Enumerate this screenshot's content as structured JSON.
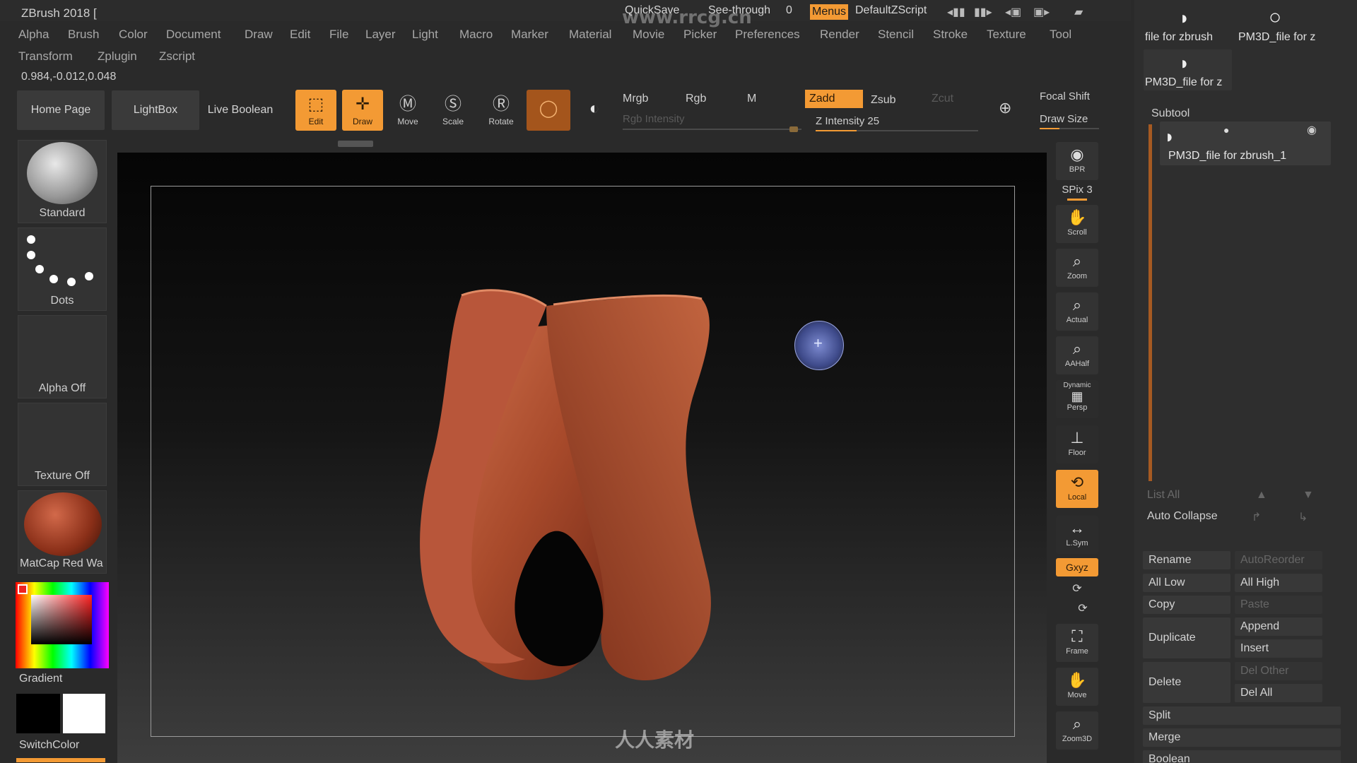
{
  "app": {
    "title": "ZBrush 2018 ["
  },
  "topbar": {
    "quicksave": "QuickSave",
    "see_through_label": "See-through",
    "see_through_value": "0",
    "menus": "Menus",
    "script": "DefaultZScript"
  },
  "menus": {
    "row1": [
      "Alpha",
      "Brush",
      "Color",
      "Document",
      "Draw",
      "Edit",
      "File",
      "Layer",
      "Light",
      "Macro",
      "Marker",
      "Material",
      "Movie",
      "Picker",
      "Preferences",
      "Render",
      "Stencil",
      "Stroke",
      "Texture",
      "Tool"
    ],
    "row2": [
      "Transform",
      "Zplugin",
      "Zscript"
    ]
  },
  "coords": "0.984,-0.012,0.048",
  "toolbar": {
    "home": "Home Page",
    "lightbox": "LightBox",
    "live_boolean": "Live Boolean",
    "edit": "Edit",
    "draw": "Draw",
    "move": "Move",
    "scale": "Scale",
    "rotate": "Rotate",
    "mrgb": "Mrgb",
    "rgb": "Rgb",
    "m": "M",
    "zadd": "Zadd",
    "zsub": "Zsub",
    "zcut": "Zcut",
    "rgb_intensity": "Rgb Intensity",
    "z_intensity": "Z Intensity 25",
    "z_intensity_value": 25,
    "focal_shift": "Focal Shift",
    "draw_size": "Draw Size"
  },
  "left_shelf": {
    "brush": "Standard",
    "stroke": "Dots",
    "alpha": "Alpha Off",
    "texture": "Texture Off",
    "material": "MatCap Red Wa",
    "gradient": "Gradient",
    "switch_color": "SwitchColor"
  },
  "right_shelf": {
    "bpr": "BPR",
    "spix": "SPix 3",
    "scroll": "Scroll",
    "zoom": "Zoom",
    "actual": "Actual",
    "aahalf": "AAHalf",
    "dynamic": "Dynamic",
    "persp": "Persp",
    "floor": "Floor",
    "local": "Local",
    "lsym": "L.Sym",
    "xyz": "Gxyz",
    "frame": "Frame",
    "move": "Move",
    "zoom3d": "Zoom3D"
  },
  "tool_panel": {
    "thumbs": [
      "file for zbrush",
      "PM3D_file for z",
      "PM3D_file for z"
    ],
    "subtool_title": "Subtool",
    "subtool_item": "PM3D_file for zbrush_1",
    "list_all": "List All",
    "auto_collapse": "Auto Collapse",
    "rename": "Rename",
    "autoreorder": "AutoReorder",
    "all_low": "All Low",
    "all_high": "All High",
    "copy": "Copy",
    "paste": "Paste",
    "duplicate": "Duplicate",
    "append": "Append",
    "insert": "Insert",
    "delete": "Delete",
    "del_other": "Del Other",
    "del_all": "Del All",
    "split": "Split",
    "merge": "Merge",
    "boolean": "Boolean"
  },
  "watermark": {
    "top": "www.rrcg.cn",
    "bottom": "人人素材"
  },
  "colors": {
    "accent": "#f39a34",
    "model": "#a84a2b"
  }
}
